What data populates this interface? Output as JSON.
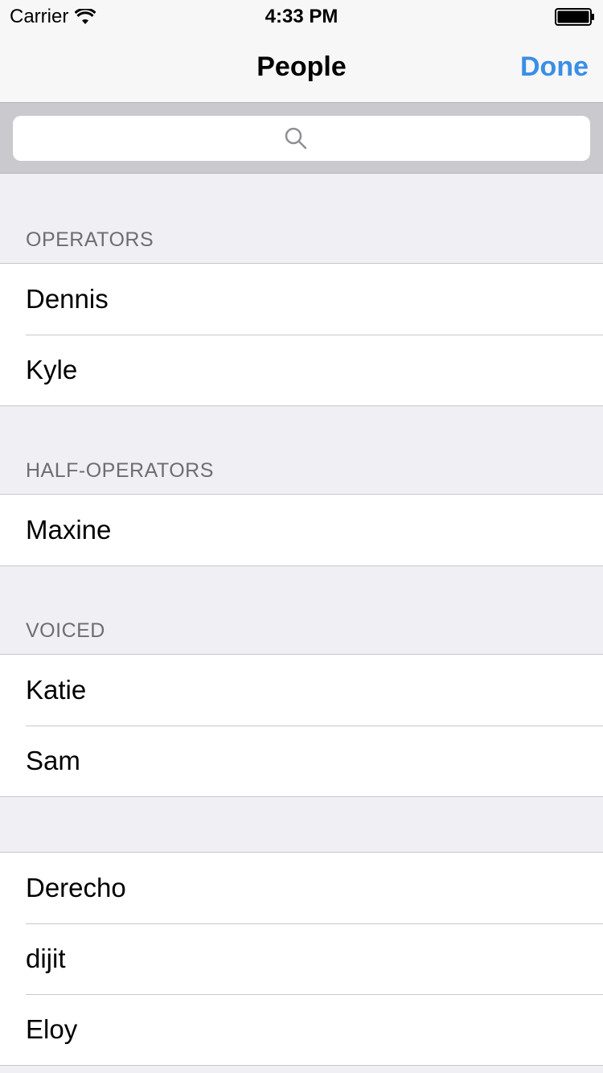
{
  "status": {
    "carrier": "Carrier",
    "time": "4:33 PM"
  },
  "nav": {
    "title": "People",
    "done_label": "Done"
  },
  "search": {
    "placeholder": ""
  },
  "sections": [
    {
      "header": "OPERATORS",
      "people": [
        "Dennis",
        "Kyle"
      ]
    },
    {
      "header": "HALF-OPERATORS",
      "people": [
        "Maxine"
      ]
    },
    {
      "header": "VOICED",
      "people": [
        "Katie",
        "Sam"
      ]
    },
    {
      "header": "",
      "people": [
        "Derecho",
        "dijit",
        "Eloy"
      ]
    }
  ],
  "colors": {
    "accent": "#3a8ee6",
    "section_bg": "#efeff4",
    "header_text": "#6d6d72"
  }
}
